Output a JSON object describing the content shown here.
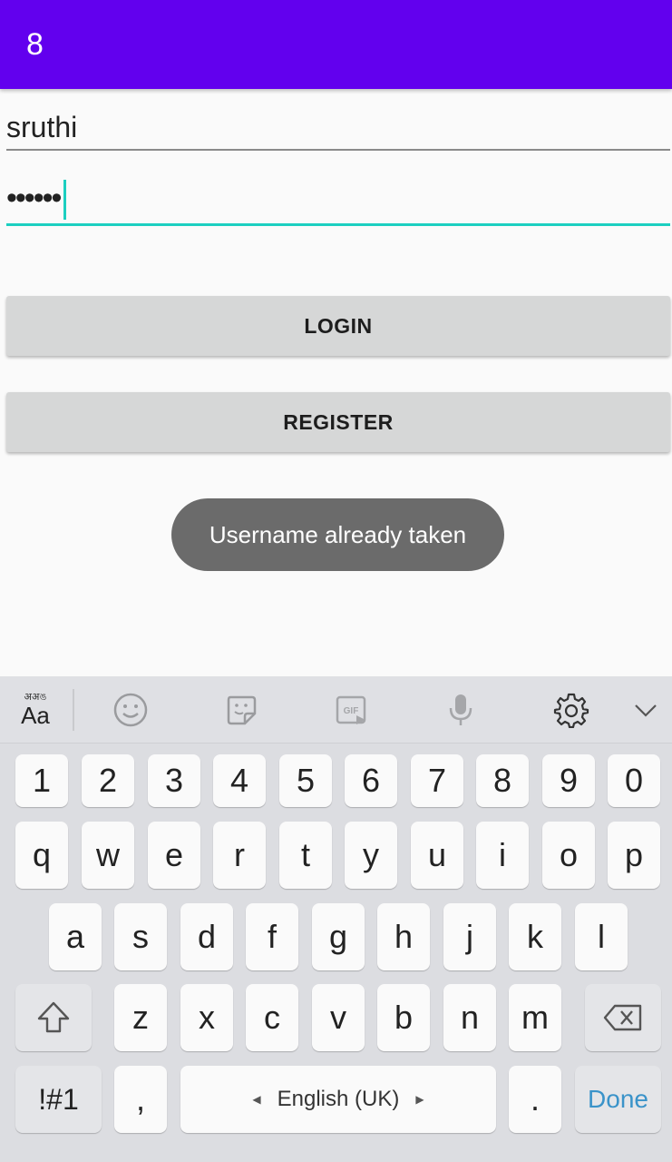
{
  "appbar": {
    "title": "8"
  },
  "form": {
    "username_value": "sruthi",
    "password_mask": "••••••"
  },
  "buttons": {
    "login": "LOGIN",
    "register": "REGISTER"
  },
  "toast": {
    "message": "Username already taken"
  },
  "keyboard": {
    "toolbar": {
      "lang_script": "अअঙ",
      "lang_label": "Aa",
      "icons": [
        "emoji-icon",
        "sticker-icon",
        "gif-icon",
        "microphone-icon",
        "settings-icon",
        "chevron-down-icon"
      ]
    },
    "number_row": [
      "1",
      "2",
      "3",
      "4",
      "5",
      "6",
      "7",
      "8",
      "9",
      "0"
    ],
    "row_q": [
      "q",
      "w",
      "e",
      "r",
      "t",
      "y",
      "u",
      "i",
      "o",
      "p"
    ],
    "row_a": [
      "a",
      "s",
      "d",
      "f",
      "g",
      "h",
      "j",
      "k",
      "l"
    ],
    "row_z": [
      "z",
      "x",
      "c",
      "v",
      "b",
      "n",
      "m"
    ],
    "symbols_key": "!#1",
    "comma_key": ",",
    "space_label": "English (UK)",
    "period_key": ".",
    "done_key": "Done"
  },
  "colors": {
    "appbar": "#6200ee",
    "accent": "#1ccfc0",
    "toast": "#6b6b6b",
    "done": "#3a93c9"
  }
}
